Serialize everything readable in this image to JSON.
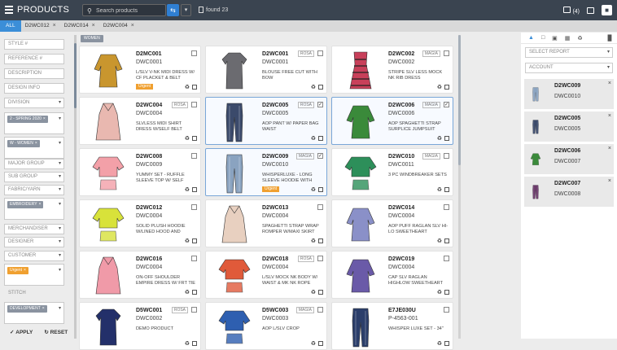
{
  "app": {
    "title": "PRODUCTS"
  },
  "search": {
    "placeholder": "Search products"
  },
  "found": {
    "label": "found 23"
  },
  "header": {
    "badge": "(4)"
  },
  "tabs": [
    {
      "label": "ALL",
      "active": true
    },
    {
      "label": "D2WC012"
    },
    {
      "label": "D2WC014"
    },
    {
      "label": "D2WC004"
    }
  ],
  "filters": {
    "fields": [
      "STYLE #",
      "REFERENCE #",
      "DESCRIPTION",
      "DESIGN INFO",
      "DIVISION"
    ],
    "season_chip": "2 - SPRING 2020",
    "women_chip": "W - WOMEN",
    "fields2": [
      "MAJOR GROUP",
      "SUB GROUP",
      "FABRIC/YARN"
    ],
    "embroidery_chip": "EMBROIDERY",
    "fields3": [
      "MERCHANDISER",
      "DESIGNER",
      "CUSTOMER"
    ],
    "urgent_chip": "Urgent",
    "stitch": "STITCH",
    "development_chip": "DEVELOPMENT",
    "apply": "APPLY",
    "reset": "RESET"
  },
  "grid": {
    "women_chip": "WOMEN",
    "cards": [
      {
        "code": "D2MC001",
        "ref": "DWC0001",
        "desc": "L/SLV V-NK MIDI DRESS W/ CF PLACKET & BELT",
        "badge": "Urgent",
        "tag": "",
        "checked": false,
        "color": "#c9962e"
      },
      {
        "code": "D2WC001",
        "ref": "DWC0001",
        "desc": "Blouse free cut with bow",
        "badge": "",
        "tag": "ROSA",
        "checked": false,
        "color": "#6b6b70"
      },
      {
        "code": "D2WC002",
        "ref": "DWC0002",
        "desc": "STRIPE SLV LESS MOCK NK RIB DRESS",
        "badge": "",
        "tag": "MAGIA",
        "checked": false,
        "color": "#c8405a"
      },
      {
        "code": "D2WC004",
        "ref": "DWC0004",
        "desc": "SLVLESS MIDI SHIRT DRESS W/SELF BELT",
        "badge": "",
        "tag": "ROSA",
        "checked": false,
        "color": "#e9b8b0"
      },
      {
        "code": "D2WC005",
        "ref": "DWC0005",
        "desc": "AOP PANT W/ PAPER BAG WAIST",
        "badge": "",
        "tag": "ROSA",
        "checked": true,
        "color": "#3b4a6b"
      },
      {
        "code": "D2WC006",
        "ref": "DWC0006",
        "desc": "AOP SPAGHETTI STRAP SURPLICE JUMPSUIT",
        "badge": "",
        "tag": "MAGIA",
        "checked": true,
        "color": "#3a8a3a"
      },
      {
        "code": "D2WC008",
        "ref": "DWC0009",
        "desc": "YUMMY SET - RUFFLE SLEEVE TOP W/ SELF",
        "badge": "",
        "tag": "",
        "checked": false,
        "color": "#f3a0a8"
      },
      {
        "code": "D2WC009",
        "ref": "DWC0010",
        "desc": "WHISPERLUXE - LONG SLEEVE HOODIE WITH",
        "badge": "Urgent",
        "tag": "MAGIA",
        "checked": true,
        "color": "#8aa3c0"
      },
      {
        "code": "D2WC010",
        "ref": "DWC0011",
        "desc": "3 PC WINDBREAKER SETS",
        "badge": "",
        "tag": "MAGIA",
        "checked": false,
        "color": "#2d8f5a"
      },
      {
        "code": "D2WC012",
        "ref": "DWC0004",
        "desc": "SOLID PLUSH HOODIE W/LINED HOOD AND",
        "badge": "",
        "tag": "",
        "checked": false,
        "color": "#d8e23a"
      },
      {
        "code": "D2WC013",
        "ref": "DWC0004",
        "desc": "SPAGHETTI STRAP WRAP ROMPER W/MAXI SKIRT",
        "badge": "",
        "tag": "",
        "checked": false,
        "color": "#e8d0c0"
      },
      {
        "code": "D2WC014",
        "ref": "DWC0004",
        "desc": "AOP PUFF RAGLAN SLV HI-LO SWEETHEART",
        "badge": "",
        "tag": "",
        "checked": false,
        "color": "#8a90c8"
      },
      {
        "code": "D2WC016",
        "ref": "DWC0004",
        "desc": "ON-OFF SHOULDER EMPIRE DRESS W/ FRT TIE",
        "badge": "",
        "tag": "",
        "checked": false,
        "color": "#f09aa8"
      },
      {
        "code": "D2WC018",
        "ref": "DWC0004",
        "desc": "L/SLV MOCK NK BODY W/ WAIST & MK NK ROPE",
        "badge": "",
        "tag": "ROSA",
        "checked": false,
        "color": "#e05a3a"
      },
      {
        "code": "D2WC019",
        "ref": "DWC0004",
        "desc": "CAP SLV RAGLAN HIGHLOW SWEETHEART",
        "badge": "",
        "tag": "",
        "checked": false,
        "color": "#6a5aa8"
      },
      {
        "code": "D5WC001",
        "ref": "DWC0002",
        "desc": "Demo Product",
        "badge": "",
        "tag": "ROSA",
        "checked": false,
        "color": "#23306a"
      },
      {
        "code": "D5WC003",
        "ref": "DWC0003",
        "desc": "AOP L/SLV CROP",
        "badge": "",
        "tag": "MAGIA",
        "checked": false,
        "color": "#2e5fb0"
      },
      {
        "code": "E7JE030U",
        "ref": "P-4563-001",
        "desc": "WHISPER LUXE SET - 34\"",
        "badge": "",
        "tag": "",
        "checked": false,
        "color": "#2b3e6a"
      }
    ]
  },
  "panel": {
    "report_placeholder": "SELECT REPORT",
    "account_placeholder": "ACCOUNT",
    "items": [
      {
        "code": "D2WC009",
        "ref": "DWC0010",
        "color": "#8aa3c0"
      },
      {
        "code": "D2WC005",
        "ref": "DWC0005",
        "color": "#3b4a6b"
      },
      {
        "code": "D2WC006",
        "ref": "DWC0007",
        "color": "#3a8a3a"
      },
      {
        "code": "D2WC007",
        "ref": "DWC0008",
        "color": "#6a3a6a"
      }
    ]
  }
}
